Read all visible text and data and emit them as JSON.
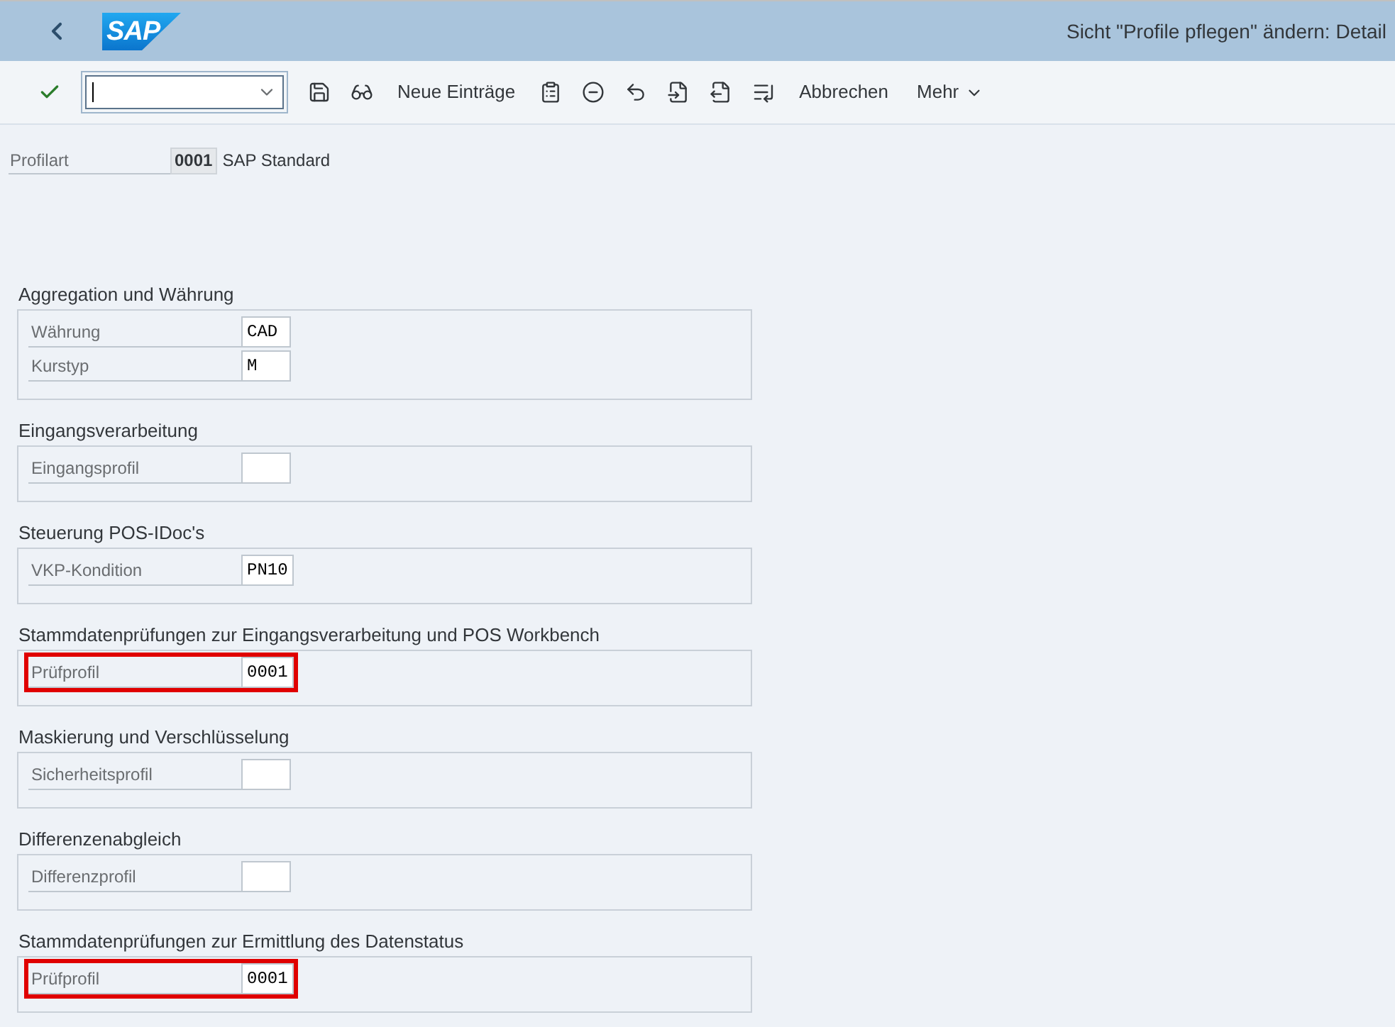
{
  "header": {
    "logo": "SAP",
    "title": "Sicht \"Profile pflegen\" ändern: Detail"
  },
  "toolbar": {
    "items": [
      {
        "kind": "icon"
      },
      {
        "kind": "command"
      },
      {
        "kind": "icon"
      },
      {
        "kind": "icon"
      },
      {
        "kind": "text",
        "label": "Neue Einträge"
      },
      {
        "kind": "icon"
      },
      {
        "kind": "icon"
      },
      {
        "kind": "icon"
      },
      {
        "kind": "icon"
      },
      {
        "kind": "icon"
      },
      {
        "kind": "icon"
      },
      {
        "kind": "text",
        "label": "Abbrechen"
      },
      {
        "kind": "menu",
        "label": "Mehr"
      }
    ]
  },
  "profile_type": {
    "label": "Profilart",
    "value": "0001",
    "description": "SAP Standard"
  },
  "sections": [
    {
      "title": "Aggregation und Währung",
      "fields": [
        {
          "label": "Währung",
          "value": "CAD",
          "highlighted": false
        },
        {
          "label": "Kurstyp",
          "value": "M",
          "highlighted": false
        }
      ]
    },
    {
      "title": "Eingangsverarbeitung",
      "fields": [
        {
          "label": "Eingangsprofil",
          "highlighted": false
        }
      ]
    },
    {
      "title": "Steuerung POS-IDoc's",
      "fields": [
        {
          "label": "VKP-Kondition",
          "value": "PN10",
          "highlighted": false
        }
      ]
    },
    {
      "title": "Stammdatenprüfungen zur Eingangsverarbeitung und POS Workbench",
      "fields": [
        {
          "label": "Prüfprofil",
          "value": "0001",
          "highlighted": true
        }
      ]
    },
    {
      "title": "Maskierung und Verschlüsselung",
      "fields": [
        {
          "label": "Sicherheitsprofil",
          "highlighted": false
        }
      ]
    },
    {
      "title": "Differenzenabgleich",
      "fields": [
        {
          "label": "Differenzprofil",
          "highlighted": false
        }
      ]
    },
    {
      "title": "Stammdatenprüfungen zur Ermittlung des Datenstatus",
      "fields": [
        {
          "label": "Prüfprofil",
          "value": "0001",
          "highlighted": true
        }
      ]
    }
  ]
}
